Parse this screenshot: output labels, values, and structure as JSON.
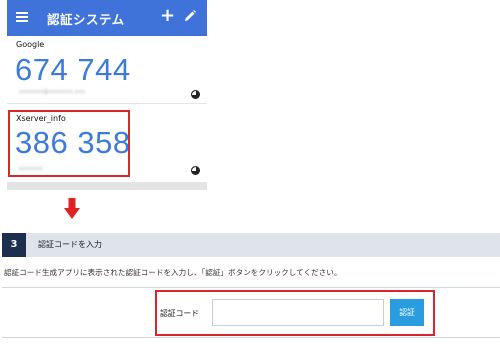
{
  "app": {
    "title": "認証システム",
    "menu_icon": "hamburger-menu-icon",
    "add_icon": "plus-icon",
    "edit_icon": "pencil-icon",
    "bar_color": "#3f73d9"
  },
  "accounts": [
    {
      "name": "Google",
      "code": "674 744",
      "subtitle": "xxxxxxx@xxxxxxx.xxx"
    },
    {
      "name": "Xserver_info",
      "code": "386 358",
      "subtitle": "xxxxxxx"
    }
  ],
  "step": {
    "number": "3",
    "title": "認証コードを入力",
    "description": "認証コード生成アプリに表示された認証コードを入力し、「認証」ボタンをクリックしてください。",
    "field_label": "認証コード",
    "input_value": "",
    "button_label": "認証"
  },
  "colors": {
    "code_blue": "#3d7bd8",
    "highlight_red": "#d9262c",
    "step_navy": "#1d2f4f",
    "button_blue": "#2a9de0"
  }
}
